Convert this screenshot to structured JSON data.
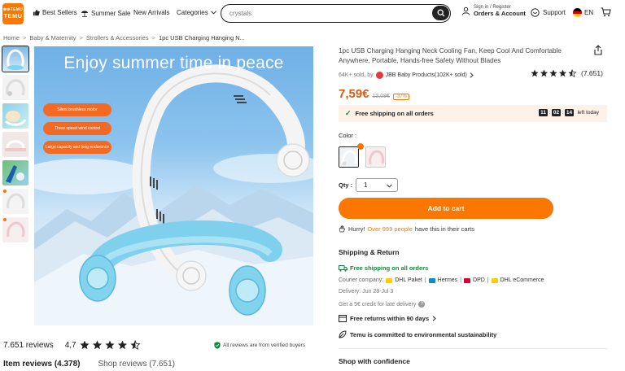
{
  "header": {
    "logo_top": "⊕⊕TEMU",
    "logo_bottom": "TEMU",
    "nav": [
      {
        "label": "Best Sellers",
        "icon": "thumbs-up-icon"
      },
      {
        "label": "Summer Sale",
        "icon": "beach-umbrella-icon"
      },
      {
        "label": "New Arrivals",
        "icon": ""
      },
      {
        "label": "Categories",
        "icon": "chevron-down-icon"
      }
    ],
    "search_value": "crystals",
    "account_small": "Sign in / Register",
    "account_big": "Orders & Account",
    "support": "Support",
    "language": "EN",
    "accent": "#fb7701"
  },
  "breadcrumb": [
    "Home",
    "Baby & Maternity",
    "Strollers & Accessories",
    "1pc USB Charging Hanging N..."
  ],
  "main_image": {
    "headline": "Enjoy summer time in peace",
    "pills": [
      "Silent brushless motor",
      "Three speed wind control",
      "Large capacity and long endurance"
    ]
  },
  "product": {
    "title": "1pc USB Charging Hanging Neck Cooling Fan, Keep Cool And Comfortable Anywhere, Portable, Hands-free Safety Without Blades",
    "sold": "64K+ sold, by",
    "store": "JBB Baby Products(102K+ sold)",
    "rating_count": "(7.651)",
    "rating_value": 4.7,
    "price": "7,59€",
    "old_price": "12,09€",
    "discount": "-37%",
    "shipping": "Free shipping on all orders",
    "timer": [
      "11",
      "02",
      "14"
    ],
    "timer_label": "left today",
    "color_label": "Color :",
    "qty_label": "Qty :",
    "qty_value": "1",
    "add_to_cart": "Add to cart",
    "hurry_prefix": "Hurry!",
    "hurry_highlight": "Over 999 people",
    "hurry_suffix": "have this in their carts"
  },
  "shipping": {
    "title": "Shipping & Return",
    "free": "Free shipping on all orders",
    "courier_label": "Courier company:",
    "couriers": [
      {
        "name": "DHL Paket",
        "color": "#ffcc00"
      },
      {
        "name": "Hermes",
        "color": "#0091cd"
      },
      {
        "name": "DPD",
        "color": "#dc0032"
      },
      {
        "name": "DHL eCommerce",
        "color": "#ffcc00"
      }
    ],
    "delivery": "Delivery: Jun 28-Jul 3",
    "credit": "Get a 5€ credit for late delivery",
    "returns": "Free returns within 90 days",
    "sustainability": "Temu is committed to environmental sustainability",
    "confidence": "Shop with confidence"
  },
  "reviews": {
    "count": "7.651 reviews",
    "avg": "4,7",
    "verified": "All reviews are from verified buyers",
    "tab_item": "Item reviews (4.378)",
    "tab_shop": "Shop reviews (7.651)"
  }
}
